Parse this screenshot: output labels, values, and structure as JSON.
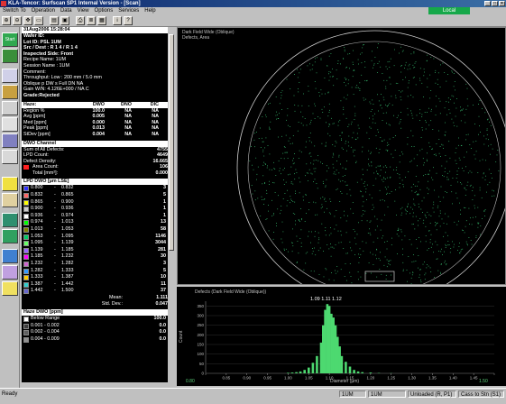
{
  "window": {
    "title": "KLA-Tencor:  Surfscan SP1 Internal Version - [Scan]"
  },
  "local_label": "Local",
  "menu": [
    "Switch To",
    "Operation",
    "Data",
    "View",
    "Options",
    "Services",
    "Help"
  ],
  "left_buttons": [
    "Start",
    "",
    "",
    "",
    "",
    "",
    "",
    "",
    "",
    "",
    "",
    "",
    "",
    "",
    ""
  ],
  "wafer": {
    "datetime": "31Aug2006  15:28:04",
    "wafer_id": "Wafer ID:",
    "lot_id": "Lot ID: PSL 1UM",
    "src_dest": "Src / Dest :  R 1  4   /  R 1   4",
    "inspected_side": "Inspected Side:  Front",
    "recipe": "Recipe Name:  1UM",
    "session": "Session Name : 1UM",
    "comment": "Comment:",
    "throughput": "Throughput:  Low  :  200  mm  /  5.0  mm",
    "oblique": "Oblique  p  DW  s  Full   DN   NA",
    "gain": "Gain W/N: 4.126E+000 / NA  C",
    "grade": "Grade:Rejected"
  },
  "stats": {
    "headers": [
      "Haze:",
      "DWO",
      "DNO",
      "DIC"
    ],
    "rows": [
      [
        "Region %",
        "100.0",
        "NA",
        "NA"
      ],
      [
        "Avg [ppm]",
        "0.005",
        "NA",
        "NA"
      ],
      [
        "Med [ppm]",
        "0.000",
        "NA",
        "NA"
      ],
      [
        "Peak [ppm]",
        "0.013",
        "NA",
        "NA"
      ],
      [
        "StDev [ppm]",
        "0.004",
        "NA",
        "NA"
      ]
    ]
  },
  "dwo": {
    "header": "DWO Channel",
    "rows": [
      [
        "Sum of All Defects:",
        "4755"
      ],
      [
        "LPD Count:",
        "4649"
      ],
      [
        "Defect Density:",
        "16.665"
      ],
      [
        "Area Count:",
        "106"
      ],
      [
        "Total [mm²]:",
        "0.000"
      ]
    ]
  },
  "lpd": {
    "header": "LPD DWO [µm LSE]",
    "bins": [
      {
        "lo": "0.800",
        "hi": "0.832",
        "count": "3",
        "color": "#3333ff"
      },
      {
        "lo": "0.832",
        "hi": "0.865",
        "count": "5",
        "color": "#ff6666"
      },
      {
        "lo": "0.865",
        "hi": "0.900",
        "count": "1",
        "color": "#ffff00"
      },
      {
        "lo": "0.900",
        "hi": "0.936",
        "count": "1",
        "color": "#cccccc"
      },
      {
        "lo": "0.936",
        "hi": "0.974",
        "count": "1",
        "color": "#ffffff"
      },
      {
        "lo": "0.974",
        "hi": "1.013",
        "count": "13",
        "color": "#00ff00"
      },
      {
        "lo": "1.013",
        "hi": "1.053",
        "count": "58",
        "color": "#808000"
      },
      {
        "lo": "1.053",
        "hi": "1.095",
        "count": "1146",
        "color": "#00cc66"
      },
      {
        "lo": "1.095",
        "hi": "1.139",
        "count": "3044",
        "color": "#66ff66"
      },
      {
        "lo": "1.139",
        "hi": "1.185",
        "count": "281",
        "color": "#9966ff"
      },
      {
        "lo": "1.185",
        "hi": "1.232",
        "count": "30",
        "color": "#ff00ff"
      },
      {
        "lo": "1.232",
        "hi": "1.282",
        "count": "3",
        "color": "#cc66cc"
      },
      {
        "lo": "1.282",
        "hi": "1.333",
        "count": "5",
        "color": "#3399ff"
      },
      {
        "lo": "1.333",
        "hi": "1.387",
        "count": "10",
        "color": "#ffcc00"
      },
      {
        "lo": "1.387",
        "hi": "1.442",
        "count": "11",
        "color": "#33cccc"
      },
      {
        "lo": "1.442",
        "hi": "1.500",
        "count": "37",
        "color": "#6666cc"
      }
    ],
    "mean_label": "Mean:",
    "mean": "1.111",
    "std_label": "Std. Dev.:",
    "std": "0.047"
  },
  "haze": {
    "header": "Haze DWO [ppm]",
    "rows": [
      {
        "label": "Below Range",
        "value": "100.0"
      },
      {
        "label": "0.001  -  0.002",
        "value": "0.0"
      },
      {
        "label": "0.002  -  0.004",
        "value": "0.0"
      },
      {
        "label": "0.004  -  0.009",
        "value": "0.0"
      }
    ]
  },
  "map": {
    "label_line1": "Dark Field Wide (Oblique)",
    "label_line2": "Defects, Area",
    "dot_color": "#3cd07a",
    "ring_color": "#d0d0d0"
  },
  "histogram": {
    "title": "Defects (Dark Field Wide (Oblique))",
    "peak_labels": "1.09 1.11 1.12",
    "ylabel": "Count",
    "xlabel": "Diameter (µm)",
    "x_left": "0.80",
    "x_right": "1.50",
    "bar_color": "#4dd970"
  },
  "chart_data": {
    "type": "bar",
    "title": "Defects (Dark Field Wide (Oblique))",
    "xlabel": "Diameter (µm)",
    "ylabel": "Count",
    "xlim": [
      0.8,
      1.5
    ],
    "ylim": [
      0,
      375
    ],
    "y_ticks": [
      0,
      50,
      100,
      150,
      200,
      250,
      300,
      350
    ],
    "x_ticks": [
      0.8,
      0.85,
      0.9,
      0.95,
      1.0,
      1.05,
      1.1,
      1.15,
      1.2,
      1.25,
      1.3,
      1.35,
      1.4,
      1.45,
      1.5
    ],
    "x": [
      1.0,
      1.01,
      1.02,
      1.03,
      1.04,
      1.05,
      1.06,
      1.07,
      1.08,
      1.085,
      1.09,
      1.095,
      1.1,
      1.105,
      1.11,
      1.115,
      1.12,
      1.125,
      1.13,
      1.14,
      1.15,
      1.16,
      1.17,
      1.18,
      1.2,
      1.22,
      1.25
    ],
    "values": [
      3,
      4,
      6,
      10,
      18,
      30,
      55,
      90,
      160,
      250,
      330,
      360,
      350,
      310,
      290,
      250,
      190,
      140,
      90,
      60,
      35,
      18,
      10,
      6,
      4,
      2,
      1
    ],
    "annotations": [
      "1.09",
      "1.11",
      "1.12"
    ]
  },
  "status": {
    "ready": "Ready",
    "cells": [
      "1UM",
      "1UM",
      "Unloaded (R, P1)",
      "Cass to Stn (S1)"
    ]
  }
}
